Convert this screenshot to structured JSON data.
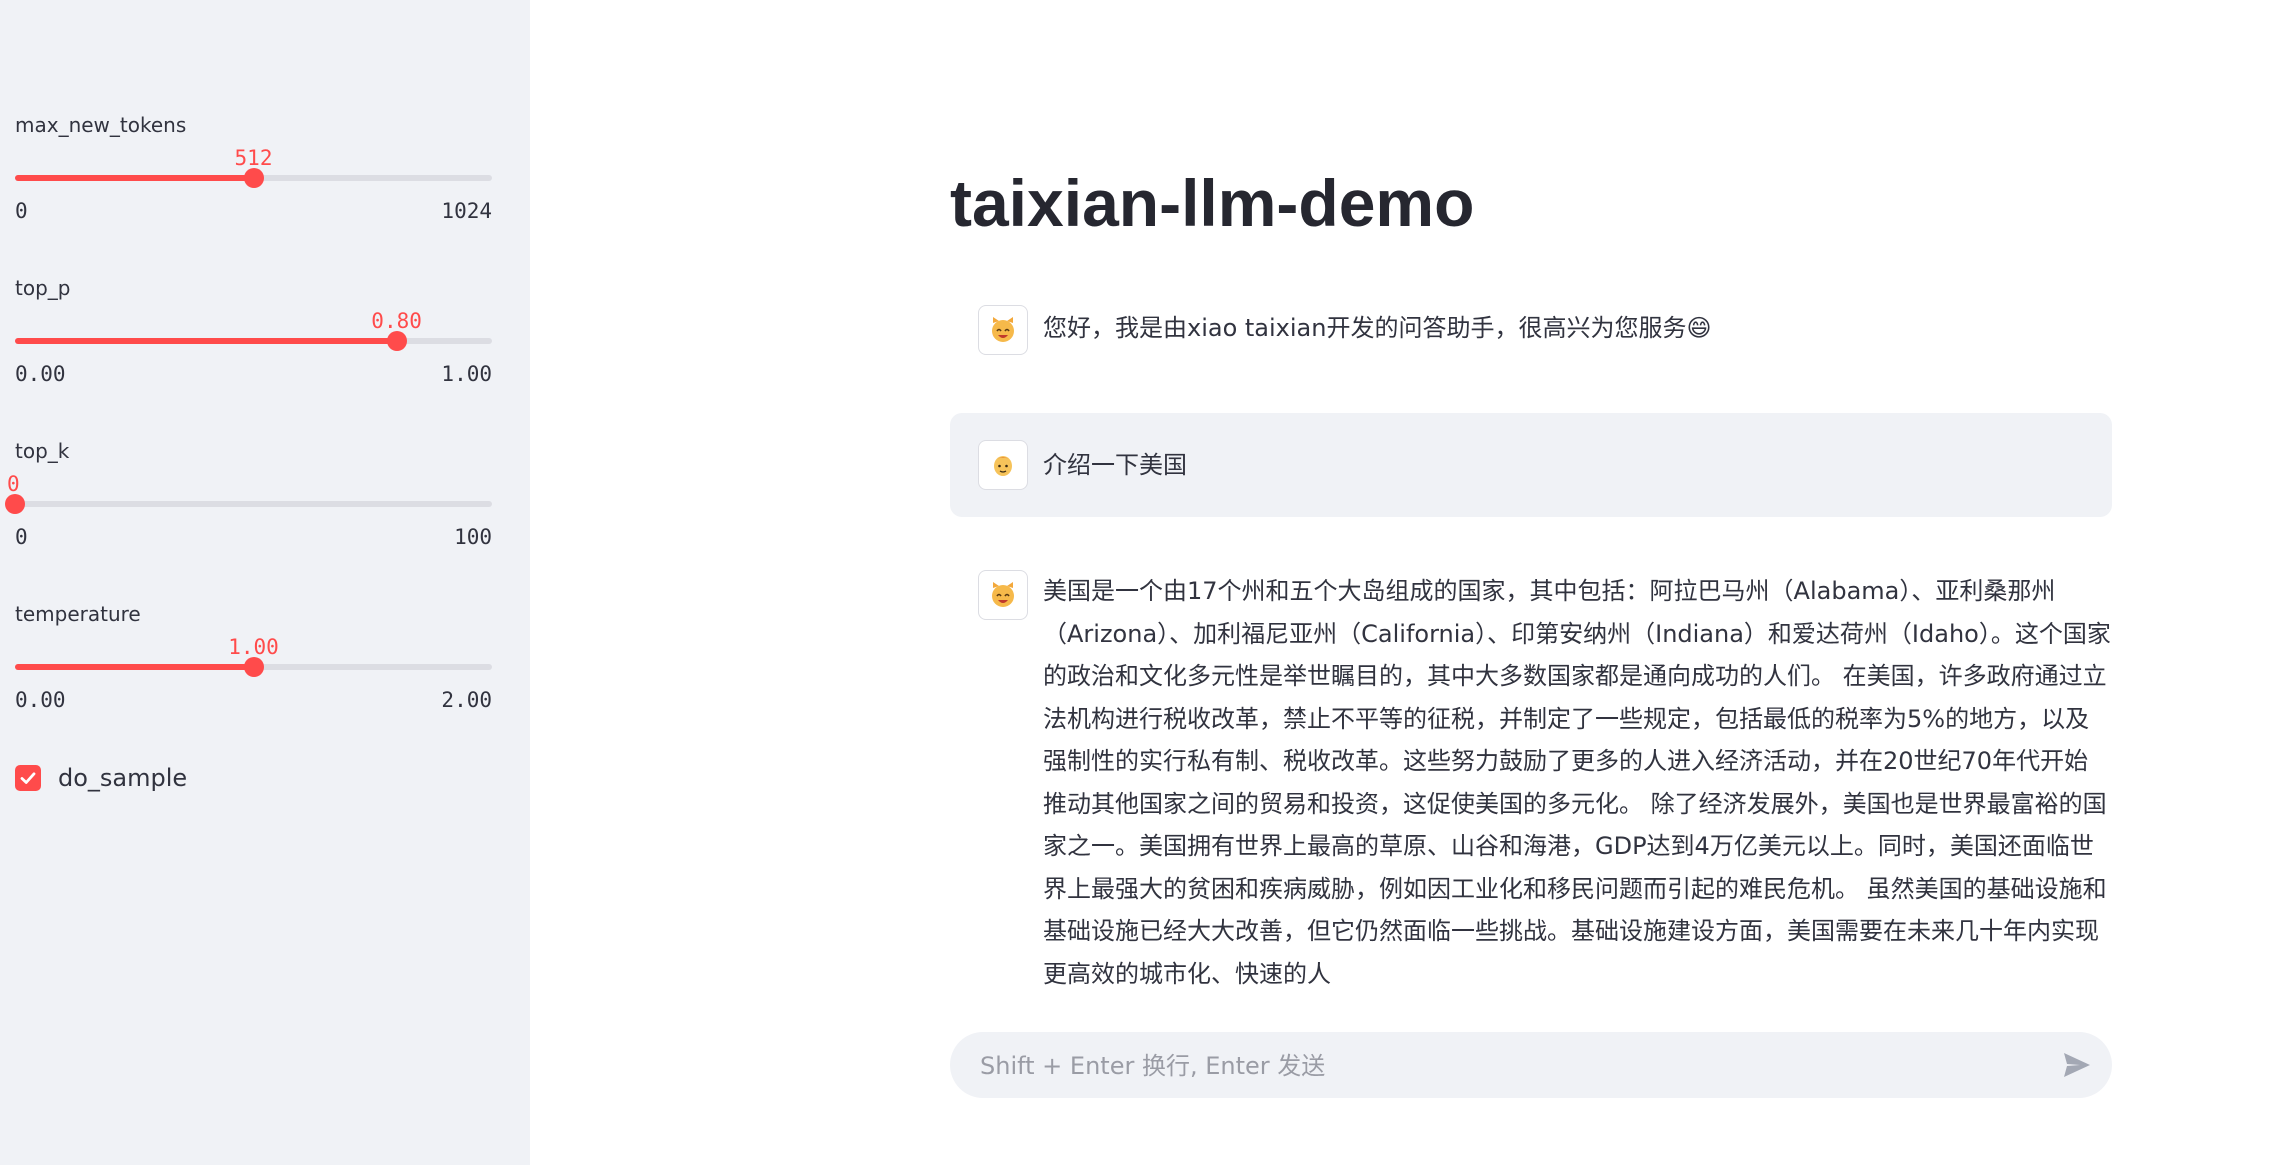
{
  "sidebar": {
    "sliders": [
      {
        "label": "max_new_tokens",
        "value": "512",
        "min": "0",
        "max": "1024",
        "fraction": 0.5
      },
      {
        "label": "top_p",
        "value": "0.80",
        "min": "0.00",
        "max": "1.00",
        "fraction": 0.8
      },
      {
        "label": "top_k",
        "value": "0",
        "min": "0",
        "max": "100",
        "fraction": 0.0
      },
      {
        "label": "temperature",
        "value": "1.00",
        "min": "0.00",
        "max": "2.00",
        "fraction": 0.5
      }
    ],
    "do_sample": {
      "label": "do_sample",
      "checked": true
    }
  },
  "main": {
    "title": "taixian-llm-demo",
    "messages": [
      {
        "role": "assistant",
        "avatar_icon": "cat-face-icon",
        "text": "您好，我是由xiao taixian开发的问答助手，很高兴为您服务😄"
      },
      {
        "role": "user",
        "avatar_icon": "person-icon",
        "text": "介绍一下美国"
      },
      {
        "role": "assistant",
        "avatar_icon": "cat-face-icon",
        "text": "美国是一个由17个州和五个大岛组成的国家，其中包括：阿拉巴马州（Alabama）、亚利桑那州（Arizona）、加利福尼亚州（California）、印第安纳州（Indiana）和爱达荷州（Idaho）。这个国家的政治和文化多元性是举世瞩目的，其中大多数国家都是通向成功的人们。 在美国，许多政府通过立法机构进行税收改革，禁止不平等的征税，并制定了一些规定，包括最低的税率为5%的地方，以及强制性的实行私有制、税收改革。这些努力鼓励了更多的人进入经济活动，并在20世纪70年代开始推动其他国家之间的贸易和投资，这促使美国的多元化。 除了经济发展外，美国也是世界最富裕的国家之一。美国拥有世界上最高的草原、山谷和海港，GDP达到4万亿美元以上。同时，美国还面临世界上最强大的贫困和疾病威胁，例如因工业化和移民问题而引起的难民危机。 虽然美国的基础设施和基础设施已经大大改善，但它仍然面临一些挑战。基础设施建设方面，美国需要在未来几十年内实现更高效的城市化、快速的人"
      }
    ],
    "chat_input": {
      "placeholder": "Shift + Enter 换行, Enter 发送"
    }
  },
  "colors": {
    "accent": "#ff4b4b",
    "sidebar_bg": "#f0f2f6",
    "track": "#dcdde3",
    "text": "#31333f"
  }
}
